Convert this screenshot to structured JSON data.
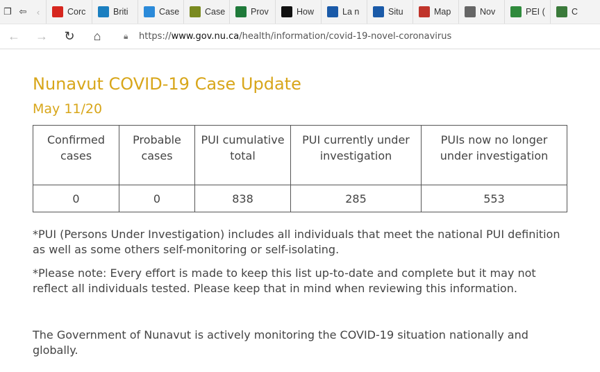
{
  "browser": {
    "tabs": [
      {
        "label": "Corc",
        "color": "#d6261e",
        "icon": "maple-leaf-icon"
      },
      {
        "label": "Briti",
        "color": "#1b7fc0",
        "icon": "bc-icon"
      },
      {
        "label": "Case",
        "color": "#2b8ad9",
        "icon": "alberta-icon"
      },
      {
        "label": "Case",
        "color": "#7a8a20",
        "icon": "sask-icon"
      },
      {
        "label": "Prov",
        "color": "#1f7a3a",
        "icon": "manitoba-icon"
      },
      {
        "label": "How",
        "color": "#111111",
        "icon": "ontario-icon"
      },
      {
        "label": "La n",
        "color": "#1a5aa8",
        "icon": "quebec-icon"
      },
      {
        "label": "Situ",
        "color": "#1a5aa8",
        "icon": "quebec-icon"
      },
      {
        "label": "Map",
        "color": "#c0342b",
        "icon": "nb-icon"
      },
      {
        "label": "Nov",
        "color": "#666666",
        "icon": "ns-icon"
      },
      {
        "label": "PEI (",
        "color": "#2f8a3c",
        "icon": "pei-icon"
      },
      {
        "label": "C",
        "color": "#3a7a3a",
        "icon": "nl-icon"
      }
    ],
    "address": {
      "url_prefix": "https://",
      "url_domain": "www.gov.nu.ca",
      "url_path": "/health/information/covid-19-novel-coronavirus"
    }
  },
  "page": {
    "title": "Nunavut COVID-19 Case Update",
    "date": "May 11/20",
    "table": {
      "headers": [
        "Confirmed cases",
        "Probable cases",
        "PUI cumulative total",
        "PUI currently under investigation",
        "PUIs now no longer under investigation"
      ],
      "rows": [
        [
          "0",
          "0",
          "838",
          "285",
          "553"
        ]
      ]
    },
    "note_pui": "*PUI (Persons Under Investigation) includes all individuals that meet the national PUI definition as well as some others self-monitoring or self-isolating.",
    "note_please": "*Please note: Every effort is made to keep this list up-to-date and complete but it may not reflect all individuals tested. Please keep that in mind when reviewing this information.",
    "statement": "The Government of Nunavut is actively monitoring the COVID-19 situation nationally and globally."
  }
}
